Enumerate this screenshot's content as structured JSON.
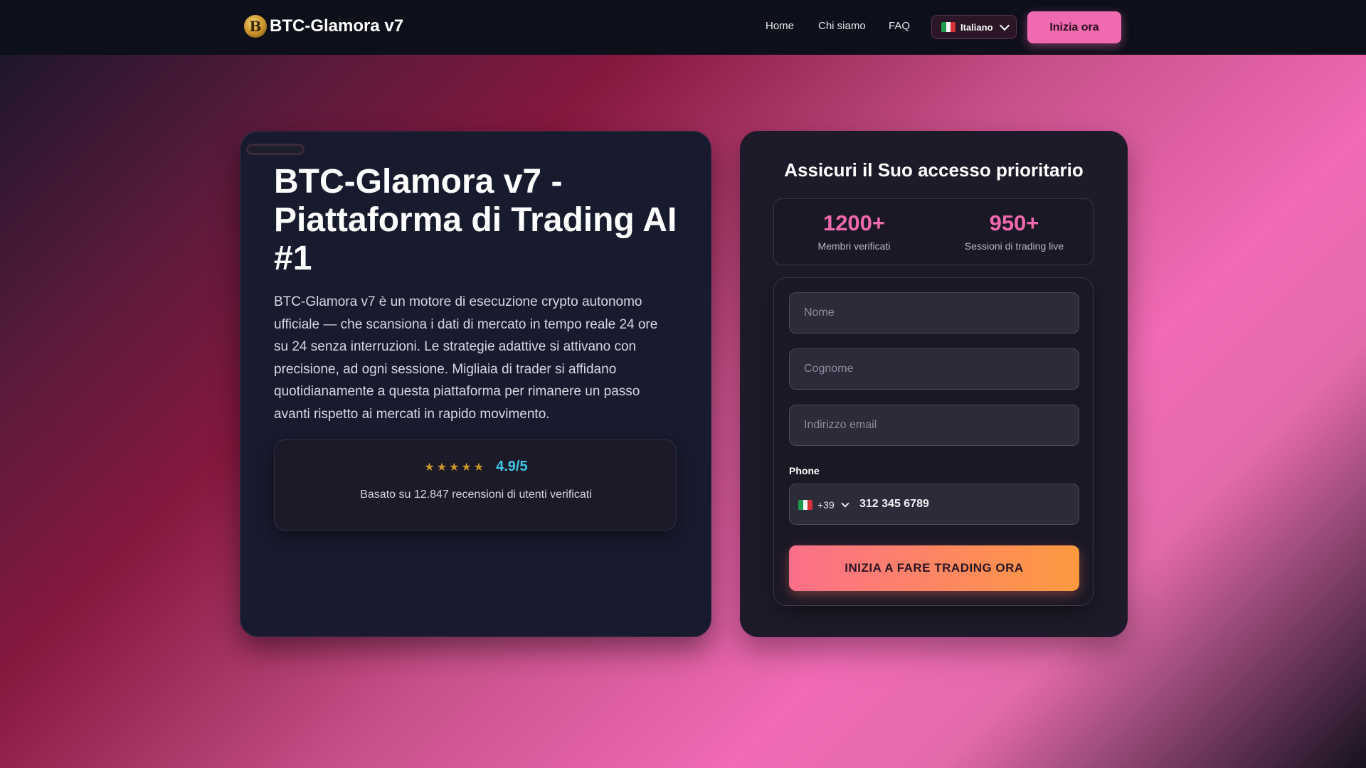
{
  "header": {
    "logo_glyph": "B",
    "brand": "BTC-Glamora v7",
    "nav": [
      "Home",
      "Chi siamo",
      "FAQ"
    ],
    "language": "Italiano",
    "cta": "Inizia ora"
  },
  "hero": {
    "title": "BTC-Glamora v7 - Piattaforma di Trading AI #1",
    "description": "BTC-Glamora v7 è un motore di esecuzione crypto autonomo ufficiale — che scansiona i dati di mercato in tempo reale 24 ore su 24 senza interruzioni. Le strategie adattive si attivano con precisione, ad ogni sessione. Migliaia di trader si affidano quotidianamente a questa piattaforma per rimanere un passo avanti rispetto ai mercati in rapido movimento.",
    "rating": {
      "stars": "★★★★★",
      "score": "4.9/5",
      "subtitle": "Basato su 12.847 recensioni di utenti verificati"
    }
  },
  "signup": {
    "title": "Assicuri il Suo accesso prioritario",
    "stats": [
      {
        "value": "1200+",
        "label": "Membri verificati"
      },
      {
        "value": "950+",
        "label": "Sessioni di trading live"
      }
    ],
    "fields": {
      "first_name_placeholder": "Nome",
      "last_name_placeholder": "Cognome",
      "email_placeholder": "Indirizzo email"
    },
    "phone": {
      "label": "Phone",
      "country_code": "+39",
      "value": "312 345 6789"
    },
    "submit": "INIZIA A FARE TRADING ORA"
  },
  "colors": {
    "accent_pink": "#f06ab0",
    "score_cyan": "#3ec8e8",
    "star_gold": "#c9952a",
    "cta_gradient_start": "#fb6f8a",
    "cta_gradient_end": "#fd9a40"
  },
  "icons": [
    "logo-coin-icon",
    "italy-flag-icon",
    "chevron-down-icon",
    "star-icon"
  ]
}
